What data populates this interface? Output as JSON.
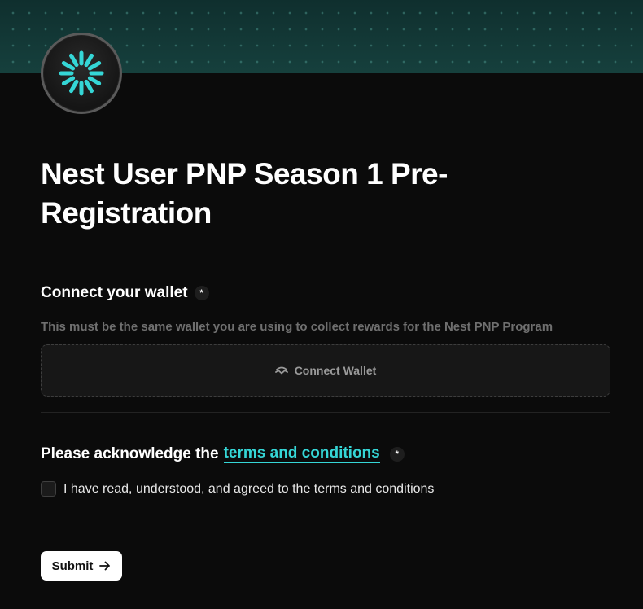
{
  "logo": {
    "icon": "spinner-sun-icon",
    "accent": "#35d6d6"
  },
  "title": "Nest User PNP Season 1 Pre-Registration",
  "wallet": {
    "label": "Connect your wallet",
    "required_mark": "*",
    "helper": "This must be the same wallet you are using to collect rewards for the Nest PNP Program",
    "button_label": "Connect Wallet",
    "button_icon": "wallet-connect-icon"
  },
  "terms": {
    "label_prefix": "Please acknowledge the",
    "link_text": "terms and conditions",
    "required_mark": "*",
    "checkbox_label": "I have read, understood, and agreed to the terms and conditions",
    "checked": false
  },
  "submit": {
    "label": "Submit",
    "icon": "arrow-right-icon"
  }
}
